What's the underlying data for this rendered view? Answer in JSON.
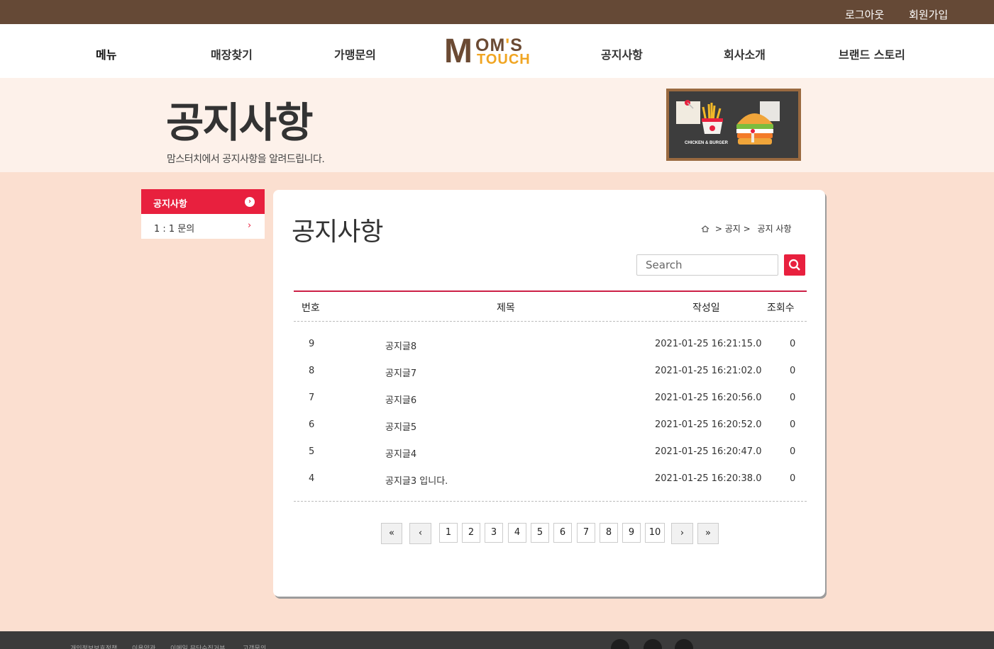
{
  "topbar": {
    "logout": "로그아웃",
    "join": "회원가입"
  },
  "nav": {
    "items": [
      "메뉴",
      "매장찾기",
      "가맹문의",
      "공지사항",
      "회사소개",
      "브랜드 스토리"
    ],
    "logo": {
      "m": "M",
      "om": "OM",
      "apos": "'",
      "s": "S",
      "touch": "TOUCH"
    }
  },
  "banner": {
    "title": "공지사항",
    "subtitle": "맘스터치에서 공지사항을 알려드립니다.",
    "board_caption": "CHICKEN & BURGER"
  },
  "side": {
    "items": [
      {
        "label": "공지사항",
        "active": true
      },
      {
        "label": "1 : 1 문의",
        "active": false
      }
    ]
  },
  "content": {
    "heading": "공지사항",
    "breadcrumb": {
      "sep1": ">",
      "mid": "공지",
      "sep2": ">",
      "current": "공지 사항"
    },
    "search": {
      "placeholder": "Search"
    },
    "table": {
      "headers": {
        "no": "번호",
        "title": "제목",
        "date": "작성일",
        "views": "조회수"
      },
      "rows": [
        {
          "no": "9",
          "title": "공지글8",
          "date": "2021-01-25 16:21:15.0",
          "views": "0"
        },
        {
          "no": "8",
          "title": "공지글7",
          "date": "2021-01-25 16:21:02.0",
          "views": "0"
        },
        {
          "no": "7",
          "title": "공지글6",
          "date": "2021-01-25 16:20:56.0",
          "views": "0"
        },
        {
          "no": "6",
          "title": "공지글5",
          "date": "2021-01-25 16:20:52.0",
          "views": "0"
        },
        {
          "no": "5",
          "title": "공지글4",
          "date": "2021-01-25 16:20:47.0",
          "views": "0"
        },
        {
          "no": "4",
          "title": "공지글3 입니다.",
          "date": "2021-01-25 16:20:38.0",
          "views": "0"
        }
      ]
    },
    "pagination": {
      "first": "«",
      "prev": "‹",
      "next": "›",
      "last": "»",
      "pages": [
        "1",
        "2",
        "3",
        "4",
        "5",
        "6",
        "7",
        "8",
        "9",
        "10"
      ]
    }
  },
  "footer": {
    "links": [
      "개인정보보호정책",
      "이용약관",
      "이메일 무단수집거부",
      "고객문의"
    ],
    "social": [
      "facebook-icon",
      "instagram-icon",
      "youtube-icon"
    ]
  },
  "colors": {
    "brown": "#654936",
    "accent": "#e8203e",
    "banner_bg": "#fdf1ea",
    "page_bg": "#fbdfd0",
    "logo_orange": "#f0a522"
  }
}
